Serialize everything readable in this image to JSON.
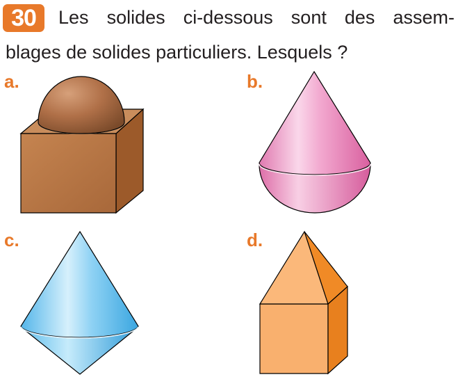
{
  "exercise": {
    "number": "30",
    "question_line1_words": [
      "Les",
      "solides",
      "ci-dessous",
      "sont",
      "des",
      "assem-"
    ],
    "question_line2": "blages de solides particuliers. Lesquels ?"
  },
  "items": [
    {
      "label": "a.",
      "icon": "hemisphere-on-cube-icon",
      "color": "#b87340"
    },
    {
      "label": "b.",
      "icon": "cone-on-hemisphere-icon",
      "color": "#e680b4"
    },
    {
      "label": "c.",
      "icon": "double-cone-icon",
      "color": "#5cbfee"
    },
    {
      "label": "d.",
      "icon": "pyramid-on-prism-icon",
      "color": "#f7a561"
    }
  ]
}
